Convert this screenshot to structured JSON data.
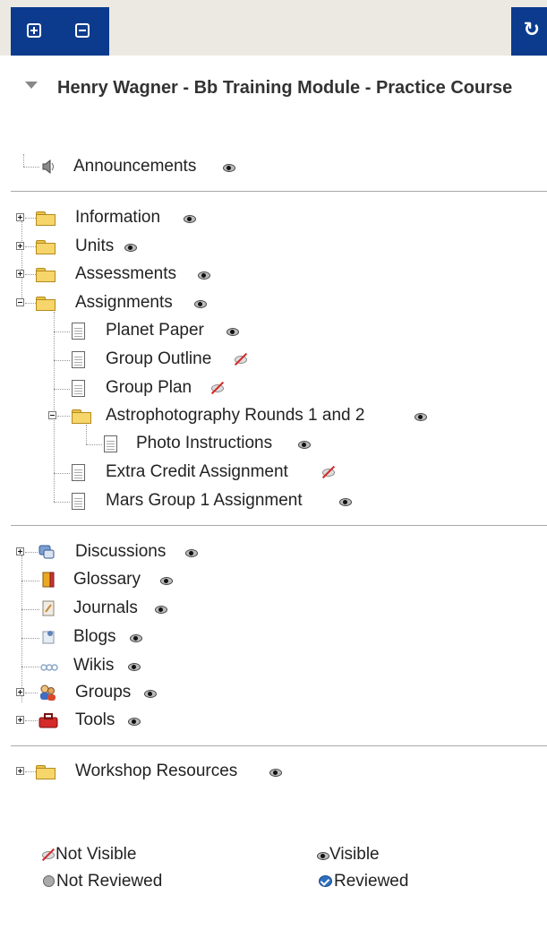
{
  "toolbar": {
    "expand_all": "expand-all",
    "collapse_all": "collapse-all",
    "refresh_glyph": "↻"
  },
  "course": {
    "title": "Henry Wagner - Bb Training Module - Practice Course"
  },
  "tree": {
    "announcements": "Announcements",
    "information": "Information",
    "units": "Units",
    "assessments": "Assessments",
    "assignments": "Assignments",
    "planet_paper": "Planet Paper",
    "group_outline": "Group Outline",
    "group_plan": "Group Plan",
    "astrophotography": "Astrophotography Rounds 1 and 2",
    "photo_instructions": "Photo Instructions",
    "extra_credit": "Extra Credit Assignment",
    "mars_group": "Mars Group 1 Assignment",
    "discussions": "Discussions",
    "glossary": "Glossary",
    "journals": "Journals",
    "blogs": "Blogs",
    "wikis": "Wikis",
    "groups": "Groups",
    "tools": "Tools",
    "workshop_resources": "Workshop Resources"
  },
  "legend": {
    "not_visible": "Not Visible",
    "visible": "Visible",
    "not_reviewed": "Not Reviewed",
    "reviewed": "Reviewed"
  },
  "colors": {
    "toolbar_blue": "#0c3b8e",
    "toolbar_bg": "#ece9e3",
    "hidden_red": "#d42a2a",
    "reviewed_blue": "#2e6fc1"
  }
}
